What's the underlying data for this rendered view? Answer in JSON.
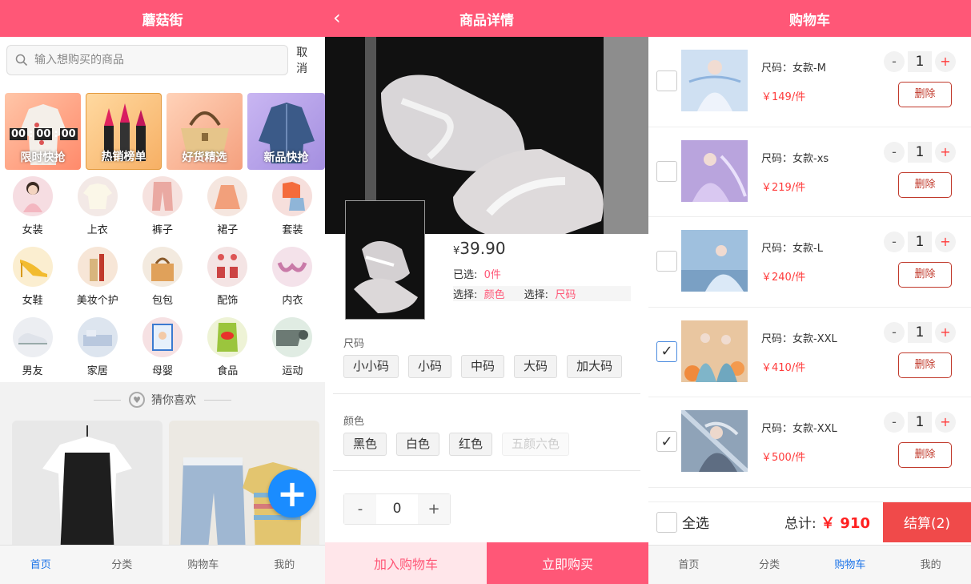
{
  "colors": {
    "brand": "#ff5777",
    "active_tab": "#1a73e8",
    "price_red": "#ff3b3b",
    "fab": "#1a8cff"
  },
  "home": {
    "title": "蘑菇街",
    "search": {
      "placeholder": "输入想购买的商品",
      "cancel": "取消"
    },
    "timer": {
      "h": "00",
      "m": "00",
      "s": "00"
    },
    "banners": [
      "限时快抢",
      "热销榜单",
      "好货精选",
      "新品快抢"
    ],
    "categories": [
      "女装",
      "上衣",
      "裤子",
      "裙子",
      "套装",
      "女鞋",
      "美妆个护",
      "包包",
      "配饰",
      "内衣",
      "男友",
      "家居",
      "母婴",
      "食品",
      "运动"
    ],
    "guess_title": "猜你喜欢",
    "fab_icon": "plus-icon",
    "tabs": [
      "首页",
      "分类",
      "购物车",
      "我的"
    ]
  },
  "detail": {
    "title": "商品详情",
    "price": "39.90",
    "currency": "¥",
    "selected_label": "已选:",
    "selected_value": "0件",
    "choose_label_1": "选择:",
    "choose_value_1": "颜色",
    "choose_label_2": "选择:",
    "choose_value_2": "尺码",
    "size_label": "尺码",
    "sizes": [
      "小小码",
      "小码",
      "中码",
      "大码",
      "加大码"
    ],
    "color_label": "颜色",
    "colors": [
      "黑色",
      "白色",
      "红色",
      "五颜六色"
    ],
    "qty": "0",
    "qty_minus": "-",
    "qty_plus": "+",
    "add_cart": "加入购物车",
    "buy_now": "立即购买"
  },
  "cart": {
    "title": "购物车",
    "items": [
      {
        "size": "尺码：女款-M",
        "price": "￥149/件",
        "qty": "1",
        "checked": false
      },
      {
        "size": "尺码：女款-xs",
        "price": "￥219/件",
        "qty": "1",
        "checked": false
      },
      {
        "size": "尺码：女款-L",
        "price": "￥240/件",
        "qty": "1",
        "checked": false
      },
      {
        "size": "尺码：女款-XXL",
        "price": "￥410/件",
        "qty": "1",
        "checked": true
      },
      {
        "size": "尺码：女款-XXL",
        "price": "￥500/件",
        "qty": "1",
        "checked": true
      }
    ],
    "delete_label": "删除",
    "minus": "-",
    "plus": "+",
    "select_all": "全选",
    "total_label": "总计:",
    "total_value": "￥ 910",
    "checkout": "结算(2)",
    "tabs": [
      "首页",
      "分类",
      "购物车",
      "我的"
    ]
  }
}
